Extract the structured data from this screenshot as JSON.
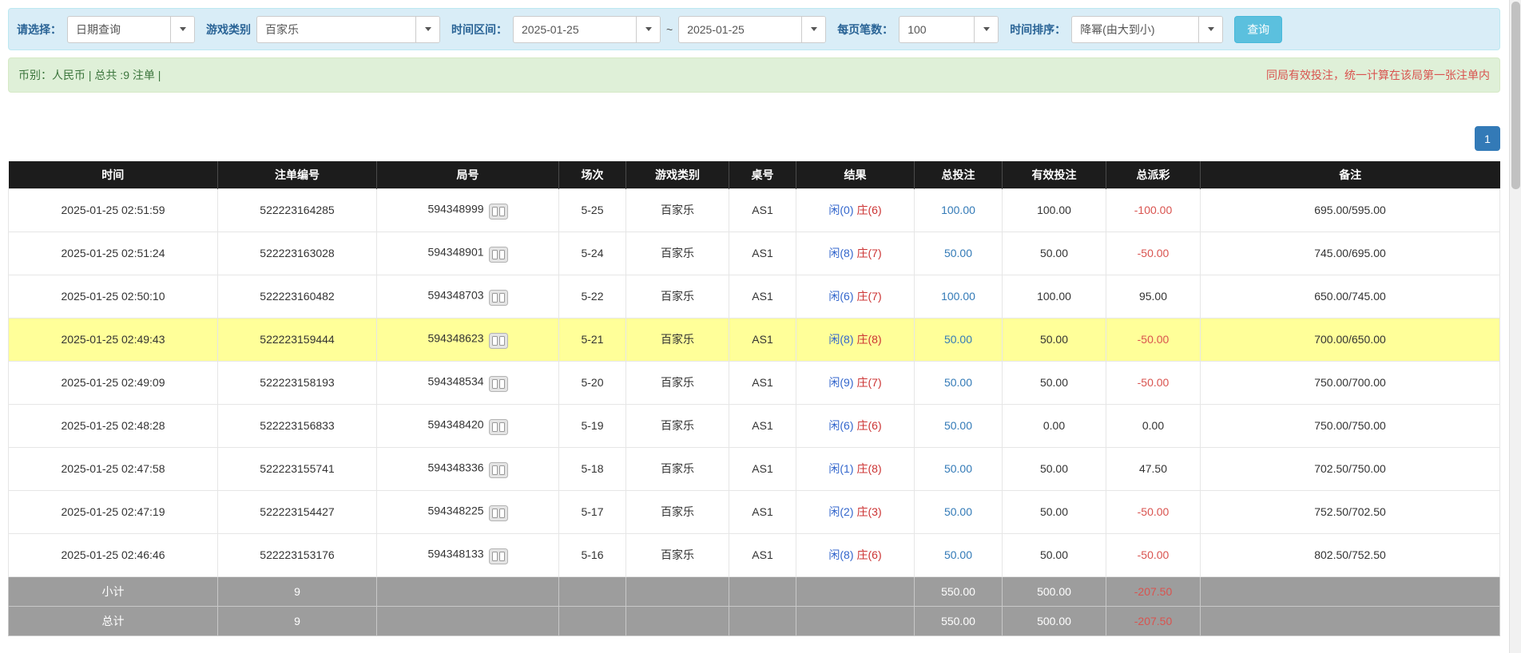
{
  "colors": {
    "filter_bar_bg": "#d9edf7",
    "summary_bar_bg": "#dff0d8",
    "accent_blue": "#337ab7",
    "search_button_bg": "#5bc0de",
    "table_header_bg": "#1c1c1c",
    "highlight_row_bg": "#ffff99",
    "footer_row_bg": "#9d9d9d",
    "player_blue": "#3366cc",
    "banker_red": "#cc3333",
    "negative_red": "#d9534f"
  },
  "filter": {
    "select_label": "请选择：",
    "select_value": "日期查询",
    "game_type_label": "游戏类别",
    "game_type_value": "百家乐",
    "date_range_label": "时间区间：",
    "date_from": "2025-01-25",
    "date_separator": "~",
    "date_to": "2025-01-25",
    "page_size_label": "每页笔数：",
    "page_size_value": "100",
    "sort_label": "时间排序：",
    "sort_value": "降幂(由大到小)",
    "search_button_label": "查询"
  },
  "summary": {
    "left_text": "币别：人民币 | 总共 :9 注单 |",
    "right_notice": "同局有效投注，统一计算在该局第一张注单内"
  },
  "pagination": {
    "current_page": "1"
  },
  "table": {
    "headers": [
      "时间",
      "注单编号",
      "局号",
      "场次",
      "游戏类别",
      "桌号",
      "结果",
      "总投注",
      "有效投注",
      "总派彩",
      "备注"
    ],
    "rows": [
      {
        "time": "2025-01-25 02:51:59",
        "bet_id": "522223164285",
        "round_id": "594348999",
        "session": "5-25",
        "game_type": "百家乐",
        "table_no": "AS1",
        "result_player": "闲(0)",
        "result_banker": "庄(6)",
        "total_bet": "100.00",
        "valid_bet": "100.00",
        "payout": "-100.00",
        "remark": "695.00/595.00",
        "highlighted": false
      },
      {
        "time": "2025-01-25 02:51:24",
        "bet_id": "522223163028",
        "round_id": "594348901",
        "session": "5-24",
        "game_type": "百家乐",
        "table_no": "AS1",
        "result_player": "闲(8)",
        "result_banker": "庄(7)",
        "total_bet": "50.00",
        "valid_bet": "50.00",
        "payout": "-50.00",
        "remark": "745.00/695.00",
        "highlighted": false
      },
      {
        "time": "2025-01-25 02:50:10",
        "bet_id": "522223160482",
        "round_id": "594348703",
        "session": "5-22",
        "game_type": "百家乐",
        "table_no": "AS1",
        "result_player": "闲(6)",
        "result_banker": "庄(7)",
        "total_bet": "100.00",
        "valid_bet": "100.00",
        "payout": "95.00",
        "remark": "650.00/745.00",
        "highlighted": false
      },
      {
        "time": "2025-01-25 02:49:43",
        "bet_id": "522223159444",
        "round_id": "594348623",
        "session": "5-21",
        "game_type": "百家乐",
        "table_no": "AS1",
        "result_player": "闲(8)",
        "result_banker": "庄(8)",
        "total_bet": "50.00",
        "valid_bet": "50.00",
        "payout": "-50.00",
        "remark": "700.00/650.00",
        "highlighted": true
      },
      {
        "time": "2025-01-25 02:49:09",
        "bet_id": "522223158193",
        "round_id": "594348534",
        "session": "5-20",
        "game_type": "百家乐",
        "table_no": "AS1",
        "result_player": "闲(9)",
        "result_banker": "庄(7)",
        "total_bet": "50.00",
        "valid_bet": "50.00",
        "payout": "-50.00",
        "remark": "750.00/700.00",
        "highlighted": false
      },
      {
        "time": "2025-01-25 02:48:28",
        "bet_id": "522223156833",
        "round_id": "594348420",
        "session": "5-19",
        "game_type": "百家乐",
        "table_no": "AS1",
        "result_player": "闲(6)",
        "result_banker": "庄(6)",
        "total_bet": "50.00",
        "valid_bet": "0.00",
        "payout": "0.00",
        "remark": "750.00/750.00",
        "highlighted": false
      },
      {
        "time": "2025-01-25 02:47:58",
        "bet_id": "522223155741",
        "round_id": "594348336",
        "session": "5-18",
        "game_type": "百家乐",
        "table_no": "AS1",
        "result_player": "闲(1)",
        "result_banker": "庄(8)",
        "total_bet": "50.00",
        "valid_bet": "50.00",
        "payout": "47.50",
        "remark": "702.50/750.00",
        "highlighted": false
      },
      {
        "time": "2025-01-25 02:47:19",
        "bet_id": "522223154427",
        "round_id": "594348225",
        "session": "5-17",
        "game_type": "百家乐",
        "table_no": "AS1",
        "result_player": "闲(2)",
        "result_banker": "庄(3)",
        "total_bet": "50.00",
        "valid_bet": "50.00",
        "payout": "-50.00",
        "remark": "752.50/702.50",
        "highlighted": false
      },
      {
        "time": "2025-01-25 02:46:46",
        "bet_id": "522223153176",
        "round_id": "594348133",
        "session": "5-16",
        "game_type": "百家乐",
        "table_no": "AS1",
        "result_player": "闲(8)",
        "result_banker": "庄(6)",
        "total_bet": "50.00",
        "valid_bet": "50.00",
        "payout": "-50.00",
        "remark": "802.50/752.50",
        "highlighted": false
      }
    ],
    "footer_rows": [
      {
        "label": "小计",
        "count": "9",
        "total_bet": "550.00",
        "valid_bet": "500.00",
        "payout": "-207.50"
      },
      {
        "label": "总计",
        "count": "9",
        "total_bet": "550.00",
        "valid_bet": "500.00",
        "payout": "-207.50"
      }
    ]
  }
}
